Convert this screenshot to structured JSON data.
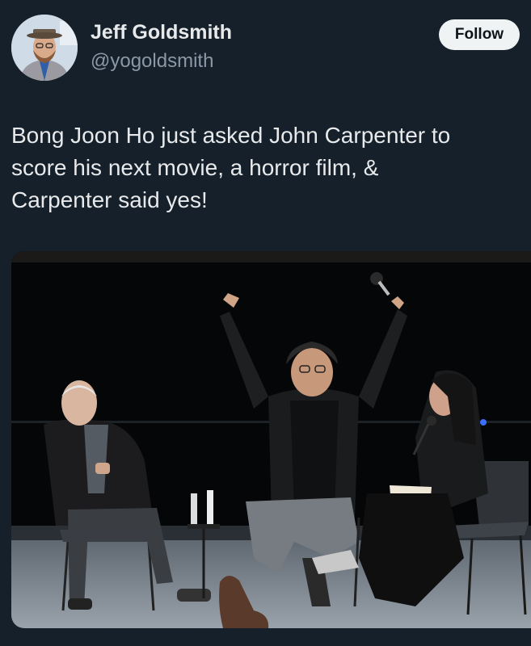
{
  "author": {
    "display_name": "Jeff Goldsmith",
    "handle": "@yogoldsmith",
    "avatar_icon": "user-avatar-photo"
  },
  "actions": {
    "follow_label": "Follow"
  },
  "tweet": {
    "text_lines": [
      "Bong Joon Ho just asked John Carpenter to",
      "score his next movie, a horror film, &",
      "Carpenter said yes!"
    ]
  },
  "media": {
    "type": "photo"
  },
  "colors": {
    "background": "#15202b",
    "text_primary": "#e7e9ea",
    "text_secondary": "#8b98a5",
    "follow_bg": "#eff3f4"
  }
}
